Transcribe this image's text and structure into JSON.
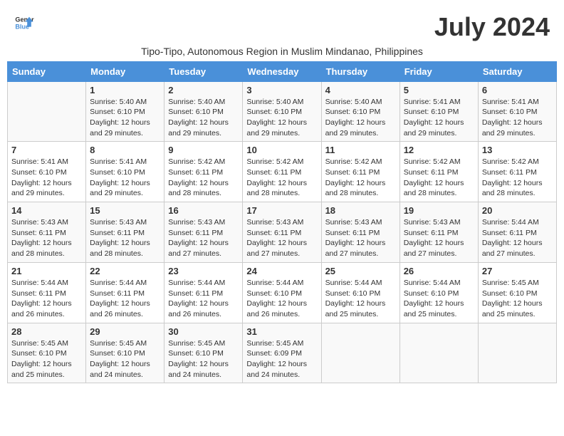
{
  "header": {
    "logo_line1": "General",
    "logo_line2": "Blue",
    "month_year": "July 2024",
    "subtitle": "Tipo-Tipo, Autonomous Region in Muslim Mindanao, Philippines"
  },
  "weekdays": [
    "Sunday",
    "Monday",
    "Tuesday",
    "Wednesday",
    "Thursday",
    "Friday",
    "Saturday"
  ],
  "weeks": [
    [
      {
        "day": "",
        "info": ""
      },
      {
        "day": "1",
        "info": "Sunrise: 5:40 AM\nSunset: 6:10 PM\nDaylight: 12 hours\nand 29 minutes."
      },
      {
        "day": "2",
        "info": "Sunrise: 5:40 AM\nSunset: 6:10 PM\nDaylight: 12 hours\nand 29 minutes."
      },
      {
        "day": "3",
        "info": "Sunrise: 5:40 AM\nSunset: 6:10 PM\nDaylight: 12 hours\nand 29 minutes."
      },
      {
        "day": "4",
        "info": "Sunrise: 5:40 AM\nSunset: 6:10 PM\nDaylight: 12 hours\nand 29 minutes."
      },
      {
        "day": "5",
        "info": "Sunrise: 5:41 AM\nSunset: 6:10 PM\nDaylight: 12 hours\nand 29 minutes."
      },
      {
        "day": "6",
        "info": "Sunrise: 5:41 AM\nSunset: 6:10 PM\nDaylight: 12 hours\nand 29 minutes."
      }
    ],
    [
      {
        "day": "7",
        "info": ""
      },
      {
        "day": "8",
        "info": "Sunrise: 5:41 AM\nSunset: 6:10 PM\nDaylight: 12 hours\nand 29 minutes."
      },
      {
        "day": "9",
        "info": "Sunrise: 5:42 AM\nSunset: 6:11 PM\nDaylight: 12 hours\nand 28 minutes."
      },
      {
        "day": "10",
        "info": "Sunrise: 5:42 AM\nSunset: 6:11 PM\nDaylight: 12 hours\nand 28 minutes."
      },
      {
        "day": "11",
        "info": "Sunrise: 5:42 AM\nSunset: 6:11 PM\nDaylight: 12 hours\nand 28 minutes."
      },
      {
        "day": "12",
        "info": "Sunrise: 5:42 AM\nSunset: 6:11 PM\nDaylight: 12 hours\nand 28 minutes."
      },
      {
        "day": "13",
        "info": "Sunrise: 5:42 AM\nSunset: 6:11 PM\nDaylight: 12 hours\nand 28 minutes."
      }
    ],
    [
      {
        "day": "14",
        "info": ""
      },
      {
        "day": "15",
        "info": "Sunrise: 5:43 AM\nSunset: 6:11 PM\nDaylight: 12 hours\nand 28 minutes."
      },
      {
        "day": "16",
        "info": "Sunrise: 5:43 AM\nSunset: 6:11 PM\nDaylight: 12 hours\nand 27 minutes."
      },
      {
        "day": "17",
        "info": "Sunrise: 5:43 AM\nSunset: 6:11 PM\nDaylight: 12 hours\nand 27 minutes."
      },
      {
        "day": "18",
        "info": "Sunrise: 5:43 AM\nSunset: 6:11 PM\nDaylight: 12 hours\nand 27 minutes."
      },
      {
        "day": "19",
        "info": "Sunrise: 5:43 AM\nSunset: 6:11 PM\nDaylight: 12 hours\nand 27 minutes."
      },
      {
        "day": "20",
        "info": "Sunrise: 5:44 AM\nSunset: 6:11 PM\nDaylight: 12 hours\nand 27 minutes."
      }
    ],
    [
      {
        "day": "21",
        "info": ""
      },
      {
        "day": "22",
        "info": "Sunrise: 5:44 AM\nSunset: 6:11 PM\nDaylight: 12 hours\nand 26 minutes."
      },
      {
        "day": "23",
        "info": "Sunrise: 5:44 AM\nSunset: 6:11 PM\nDaylight: 12 hours\nand 26 minutes."
      },
      {
        "day": "24",
        "info": "Sunrise: 5:44 AM\nSunset: 6:10 PM\nDaylight: 12 hours\nand 26 minutes."
      },
      {
        "day": "25",
        "info": "Sunrise: 5:44 AM\nSunset: 6:10 PM\nDaylight: 12 hours\nand 25 minutes."
      },
      {
        "day": "26",
        "info": "Sunrise: 5:44 AM\nSunset: 6:10 PM\nDaylight: 12 hours\nand 25 minutes."
      },
      {
        "day": "27",
        "info": "Sunrise: 5:45 AM\nSunset: 6:10 PM\nDaylight: 12 hours\nand 25 minutes."
      }
    ],
    [
      {
        "day": "28",
        "info": "Sunrise: 5:45 AM\nSunset: 6:10 PM\nDaylight: 12 hours\nand 25 minutes."
      },
      {
        "day": "29",
        "info": "Sunrise: 5:45 AM\nSunset: 6:10 PM\nDaylight: 12 hours\nand 24 minutes."
      },
      {
        "day": "30",
        "info": "Sunrise: 5:45 AM\nSunset: 6:10 PM\nDaylight: 12 hours\nand 24 minutes."
      },
      {
        "day": "31",
        "info": "Sunrise: 5:45 AM\nSunset: 6:09 PM\nDaylight: 12 hours\nand 24 minutes."
      },
      {
        "day": "",
        "info": ""
      },
      {
        "day": "",
        "info": ""
      },
      {
        "day": "",
        "info": ""
      }
    ]
  ]
}
